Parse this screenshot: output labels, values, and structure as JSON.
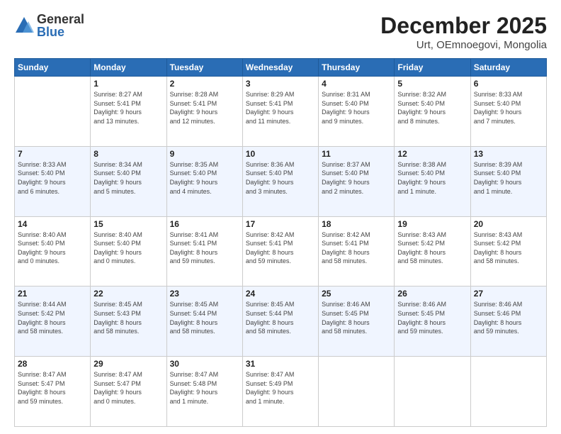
{
  "header": {
    "logo_general": "General",
    "logo_blue": "Blue",
    "month": "December 2025",
    "location": "Urt, OEmnoegovi, Mongolia"
  },
  "days_of_week": [
    "Sunday",
    "Monday",
    "Tuesday",
    "Wednesday",
    "Thursday",
    "Friday",
    "Saturday"
  ],
  "weeks": [
    [
      {
        "day": "",
        "info": ""
      },
      {
        "day": "1",
        "info": "Sunrise: 8:27 AM\nSunset: 5:41 PM\nDaylight: 9 hours\nand 13 minutes."
      },
      {
        "day": "2",
        "info": "Sunrise: 8:28 AM\nSunset: 5:41 PM\nDaylight: 9 hours\nand 12 minutes."
      },
      {
        "day": "3",
        "info": "Sunrise: 8:29 AM\nSunset: 5:41 PM\nDaylight: 9 hours\nand 11 minutes."
      },
      {
        "day": "4",
        "info": "Sunrise: 8:31 AM\nSunset: 5:40 PM\nDaylight: 9 hours\nand 9 minutes."
      },
      {
        "day": "5",
        "info": "Sunrise: 8:32 AM\nSunset: 5:40 PM\nDaylight: 9 hours\nand 8 minutes."
      },
      {
        "day": "6",
        "info": "Sunrise: 8:33 AM\nSunset: 5:40 PM\nDaylight: 9 hours\nand 7 minutes."
      }
    ],
    [
      {
        "day": "7",
        "info": "Sunrise: 8:33 AM\nSunset: 5:40 PM\nDaylight: 9 hours\nand 6 minutes."
      },
      {
        "day": "8",
        "info": "Sunrise: 8:34 AM\nSunset: 5:40 PM\nDaylight: 9 hours\nand 5 minutes."
      },
      {
        "day": "9",
        "info": "Sunrise: 8:35 AM\nSunset: 5:40 PM\nDaylight: 9 hours\nand 4 minutes."
      },
      {
        "day": "10",
        "info": "Sunrise: 8:36 AM\nSunset: 5:40 PM\nDaylight: 9 hours\nand 3 minutes."
      },
      {
        "day": "11",
        "info": "Sunrise: 8:37 AM\nSunset: 5:40 PM\nDaylight: 9 hours\nand 2 minutes."
      },
      {
        "day": "12",
        "info": "Sunrise: 8:38 AM\nSunset: 5:40 PM\nDaylight: 9 hours\nand 1 minute."
      },
      {
        "day": "13",
        "info": "Sunrise: 8:39 AM\nSunset: 5:40 PM\nDaylight: 9 hours\nand 1 minute."
      }
    ],
    [
      {
        "day": "14",
        "info": "Sunrise: 8:40 AM\nSunset: 5:40 PM\nDaylight: 9 hours\nand 0 minutes."
      },
      {
        "day": "15",
        "info": "Sunrise: 8:40 AM\nSunset: 5:40 PM\nDaylight: 9 hours\nand 0 minutes."
      },
      {
        "day": "16",
        "info": "Sunrise: 8:41 AM\nSunset: 5:41 PM\nDaylight: 8 hours\nand 59 minutes."
      },
      {
        "day": "17",
        "info": "Sunrise: 8:42 AM\nSunset: 5:41 PM\nDaylight: 8 hours\nand 59 minutes."
      },
      {
        "day": "18",
        "info": "Sunrise: 8:42 AM\nSunset: 5:41 PM\nDaylight: 8 hours\nand 58 minutes."
      },
      {
        "day": "19",
        "info": "Sunrise: 8:43 AM\nSunset: 5:42 PM\nDaylight: 8 hours\nand 58 minutes."
      },
      {
        "day": "20",
        "info": "Sunrise: 8:43 AM\nSunset: 5:42 PM\nDaylight: 8 hours\nand 58 minutes."
      }
    ],
    [
      {
        "day": "21",
        "info": "Sunrise: 8:44 AM\nSunset: 5:42 PM\nDaylight: 8 hours\nand 58 minutes."
      },
      {
        "day": "22",
        "info": "Sunrise: 8:45 AM\nSunset: 5:43 PM\nDaylight: 8 hours\nand 58 minutes."
      },
      {
        "day": "23",
        "info": "Sunrise: 8:45 AM\nSunset: 5:44 PM\nDaylight: 8 hours\nand 58 minutes."
      },
      {
        "day": "24",
        "info": "Sunrise: 8:45 AM\nSunset: 5:44 PM\nDaylight: 8 hours\nand 58 minutes."
      },
      {
        "day": "25",
        "info": "Sunrise: 8:46 AM\nSunset: 5:45 PM\nDaylight: 8 hours\nand 58 minutes."
      },
      {
        "day": "26",
        "info": "Sunrise: 8:46 AM\nSunset: 5:45 PM\nDaylight: 8 hours\nand 59 minutes."
      },
      {
        "day": "27",
        "info": "Sunrise: 8:46 AM\nSunset: 5:46 PM\nDaylight: 8 hours\nand 59 minutes."
      }
    ],
    [
      {
        "day": "28",
        "info": "Sunrise: 8:47 AM\nSunset: 5:47 PM\nDaylight: 8 hours\nand 59 minutes."
      },
      {
        "day": "29",
        "info": "Sunrise: 8:47 AM\nSunset: 5:47 PM\nDaylight: 9 hours\nand 0 minutes."
      },
      {
        "day": "30",
        "info": "Sunrise: 8:47 AM\nSunset: 5:48 PM\nDaylight: 9 hours\nand 1 minute."
      },
      {
        "day": "31",
        "info": "Sunrise: 8:47 AM\nSunset: 5:49 PM\nDaylight: 9 hours\nand 1 minute."
      },
      {
        "day": "",
        "info": ""
      },
      {
        "day": "",
        "info": ""
      },
      {
        "day": "",
        "info": ""
      }
    ]
  ]
}
